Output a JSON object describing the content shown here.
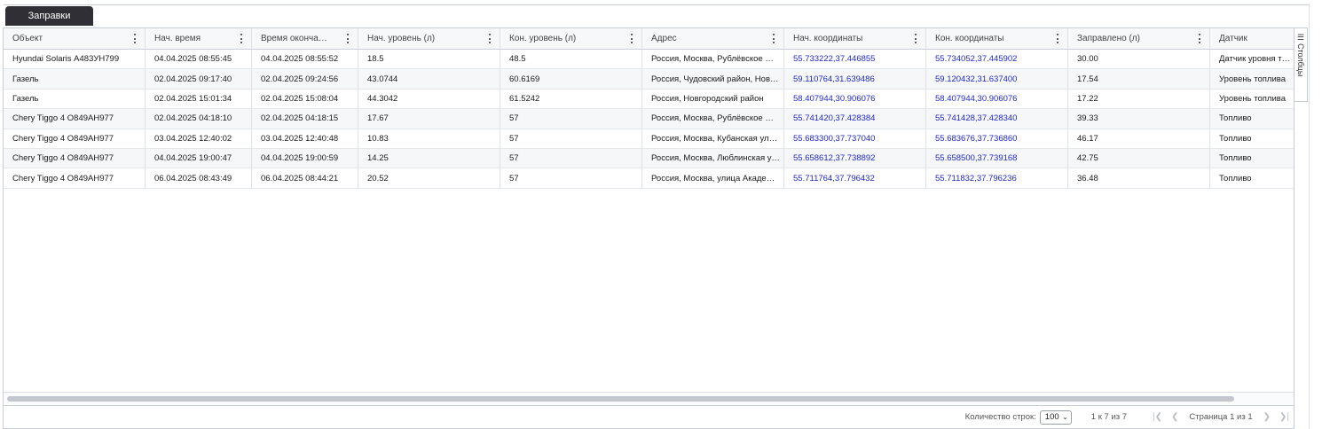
{
  "tab": {
    "label": "Заправки"
  },
  "side_panel": {
    "columns_label": "Столбцы"
  },
  "columns": [
    "Объект",
    "Нач. время",
    "Время окончан…",
    "Нач. уровень (л)",
    "Кон. уровень (л)",
    "Адрес",
    "Нач. координаты",
    "Кон. координаты",
    "Заправлено (л)",
    "Датчик"
  ],
  "rows": [
    [
      "Hyundai Solaris А483УН799",
      "04.04.2025 08:55:45",
      "04.04.2025 08:55:52",
      "18.5",
      "48.5",
      "Россия, Москва, Рублёвское шоссе",
      "55.733222,37.446855",
      "55.734052,37.445902",
      "30.00",
      "Датчик уровня топлива"
    ],
    [
      "Газель",
      "02.04.2025 09:17:40",
      "02.04.2025 09:24:56",
      "43.0744",
      "60.6169",
      "Россия, Чудовский район, Новгородская область",
      "59.110764,31.639486",
      "59.120432,31.637400",
      "17.54",
      "Уровень топлива"
    ],
    [
      "Газель",
      "02.04.2025 15:01:34",
      "02.04.2025 15:08:04",
      "44.3042",
      "61.5242",
      "Россия, Новгородский район",
      "58.407944,30.906076",
      "58.407944,30.906076",
      "17.22",
      "Уровень топлива"
    ],
    [
      "Chery Tiggo 4 О849АН977",
      "02.04.2025 04:18:10",
      "02.04.2025 04:18:15",
      "17.67",
      "57",
      "Россия, Москва, Рублёвское шоссе",
      "55.741420,37.428384",
      "55.741428,37.428340",
      "39.33",
      "Топливо"
    ],
    [
      "Chery Tiggo 4 О849АН977",
      "03.04.2025 12:40:02",
      "03.04.2025 12:40:48",
      "10.83",
      "57",
      "Россия, Москва, Кубанская улица",
      "55.683300,37.737040",
      "55.683676,37.736860",
      "46.17",
      "Топливо"
    ],
    [
      "Chery Tiggo 4 О849АН977",
      "04.04.2025 19:00:47",
      "04.04.2025 19:00:59",
      "14.25",
      "57",
      "Россия, Москва, Люблинская улица",
      "55.658612,37.738892",
      "55.658500,37.739168",
      "42.75",
      "Топливо"
    ],
    [
      "Chery Tiggo 4 О849АН977",
      "06.04.2025 08:43:49",
      "06.04.2025 08:44:21",
      "20.52",
      "57",
      "Россия, Москва, улица Академика",
      "55.711764,37.796432",
      "55.711832,37.796236",
      "36.48",
      "Топливо"
    ]
  ],
  "footer": {
    "rows_label": "Количество строк:",
    "page_size": "100",
    "range": "1 к 7 из 7",
    "page_info": "Страница 1 из 1"
  },
  "colors": {
    "tab_bg": "#2f2f35",
    "link": "#1f27c9",
    "border": "#c9ced6"
  },
  "icons": {
    "column_menu": "kebab-menu-icon",
    "columns_panel": "hamburger-menu-icon",
    "first_page": "first-page-icon",
    "prev_page": "prev-page-icon",
    "next_page": "next-page-icon",
    "last_page": "last-page-icon",
    "dropdown": "chevron-down-icon"
  }
}
